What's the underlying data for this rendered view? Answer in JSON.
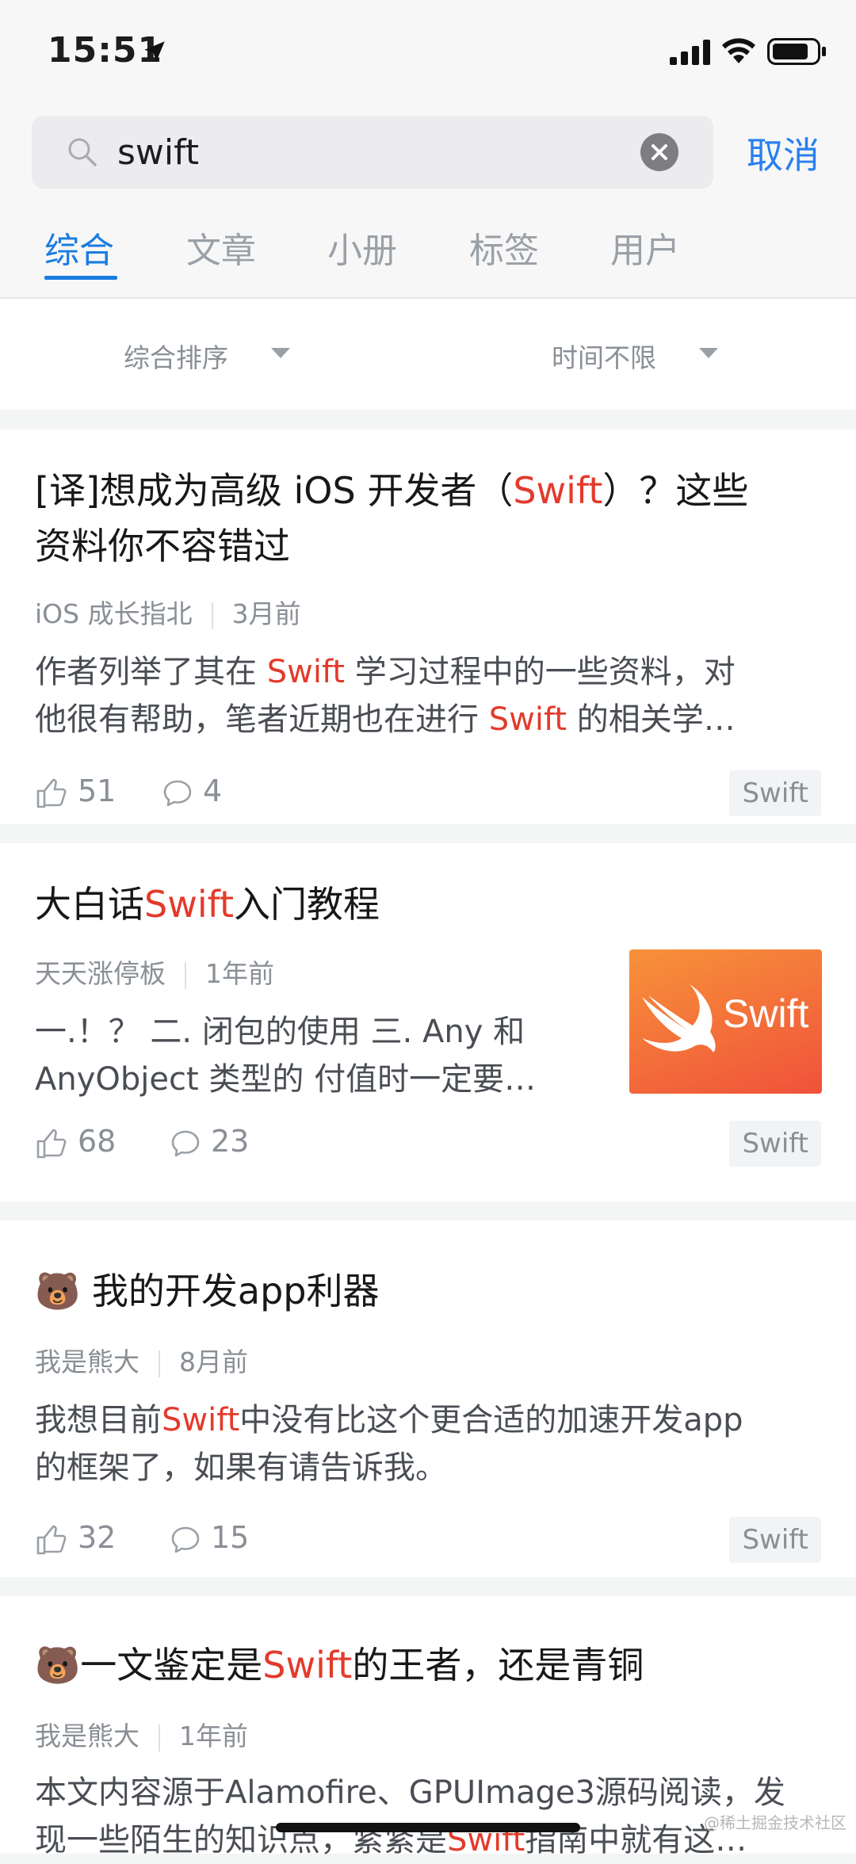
{
  "status": {
    "time": "15:51"
  },
  "search": {
    "value": "swift",
    "cancel_label": "取消"
  },
  "tabs": [
    {
      "label": "综合",
      "active": true
    },
    {
      "label": "文章",
      "active": false
    },
    {
      "label": "小册",
      "active": false
    },
    {
      "label": "标签",
      "active": false
    },
    {
      "label": "用户",
      "active": false
    }
  ],
  "filters": {
    "sort": "综合排序",
    "time": "时间不限"
  },
  "articles": [
    {
      "title_line1_pre": "[译]想成为高级 iOS 开发者（",
      "title_line1_hl": "Swift",
      "title_line1_post": "）？这些",
      "title_line2": "资料你不容错过",
      "author": "iOS 成长指北",
      "time": "3月前",
      "excerpt_l1_pre": "作者列举了其在 ",
      "excerpt_l1_hl": "Swift",
      "excerpt_l1_post": " 学习过程中的一些资料，对",
      "excerpt_l2_pre": "他很有帮助，笔者近期也在进行 ",
      "excerpt_l2_hl": "Swift",
      "excerpt_l2_post": " 的相关学…",
      "likes": "51",
      "comments": "4",
      "tag": "Swift"
    },
    {
      "title_pre": "大白话",
      "title_hl": "Swift",
      "title_post": "入门教程",
      "author": "天天涨停板",
      "time": "1年前",
      "excerpt_l1": "一.！？  二. 闭包的使用 三. Any 和",
      "excerpt_l2": "AnyObject 类型的 付值时一定要…",
      "likes": "68",
      "comments": "23",
      "tag": "Swift",
      "thumb_text": "Swift"
    },
    {
      "title": "🐻 我的开发app利器",
      "author": "我是熊大",
      "time": "8月前",
      "excerpt_l1_pre": "我想目前",
      "excerpt_l1_hl": "Swift",
      "excerpt_l1_post": "中没有比这个更合适的加速开发app",
      "excerpt_l2": "的框架了，如果有请告诉我。",
      "likes": "32",
      "comments": "15",
      "tag": "Swift"
    },
    {
      "title_pre": "🐻一文鉴定是",
      "title_hl": "Swift",
      "title_post": "的王者，还是青铜",
      "author": "我是熊大",
      "time": "1年前",
      "excerpt_l1": "本文内容源于Alamofire、GPUImage3源码阅读，发",
      "excerpt_l2_pre": "现一些陌生的知识点，紧紧是",
      "excerpt_l2_hl": "Swift",
      "excerpt_l2_post": "指南中就有这…"
    }
  ],
  "watermark": "@稀土掘金技术社区"
}
